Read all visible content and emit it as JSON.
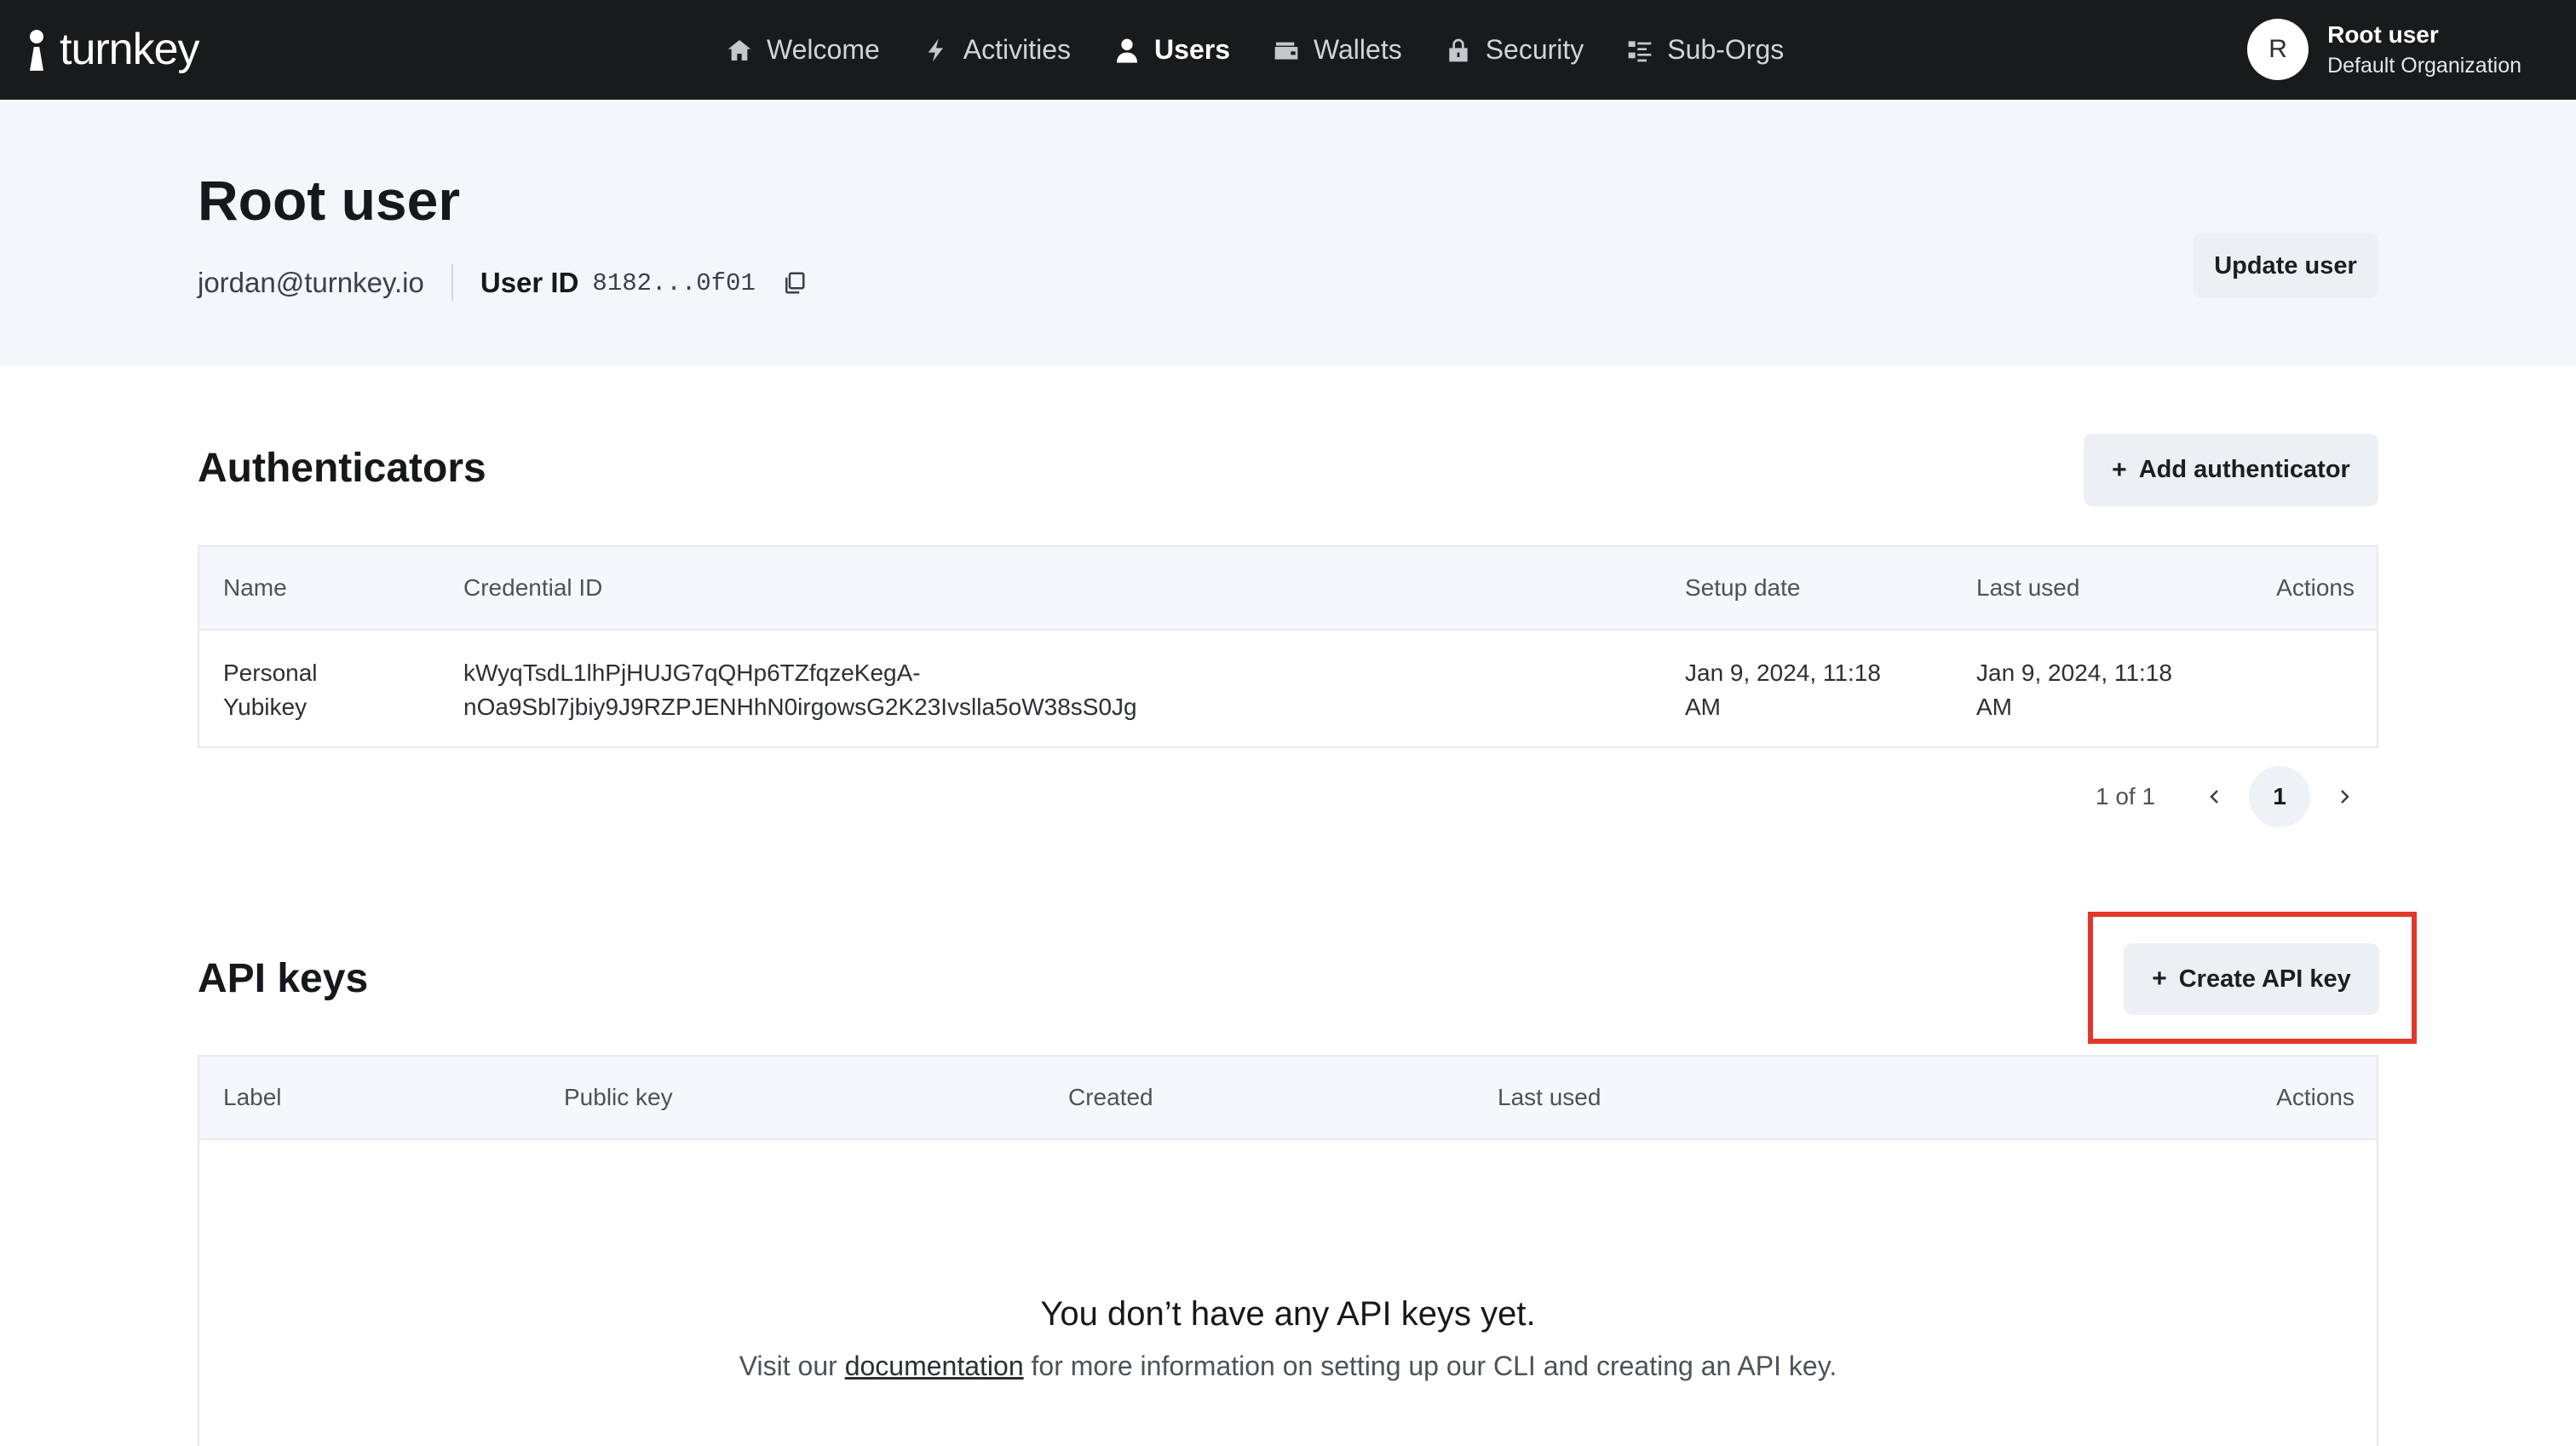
{
  "brand": {
    "name": "turnkey"
  },
  "nav": {
    "items": [
      {
        "label": "Welcome",
        "icon": "home-icon"
      },
      {
        "label": "Activities",
        "icon": "lightning-icon"
      },
      {
        "label": "Users",
        "icon": "user-icon",
        "active": true
      },
      {
        "label": "Wallets",
        "icon": "wallet-icon"
      },
      {
        "label": "Security",
        "icon": "lock-icon"
      },
      {
        "label": "Sub-Orgs",
        "icon": "list-icon"
      }
    ]
  },
  "current_user": {
    "initial": "R",
    "name": "Root user",
    "organization": "Default Organization"
  },
  "profile": {
    "title": "Root user",
    "email": "jordan@turnkey.io",
    "user_id_label": "User ID",
    "user_id_value": "8182...0f01",
    "update_button": "Update user"
  },
  "authenticators": {
    "title": "Authenticators",
    "add_button": "Add authenticator",
    "columns": [
      "Name",
      "Credential ID",
      "Setup date",
      "Last used",
      "Actions"
    ],
    "rows": [
      {
        "name_line1": "Personal",
        "name_line2": "Yubikey",
        "credential_line1": "kWyqTsdL1lhPjHUJG7qQHp6TZfqzeKegA-",
        "credential_line2": "nOa9Sbl7jbiy9J9RZPJENHhN0irgowsG2K23Ivslla5oW38sS0Jg",
        "setup_line1": "Jan 9, 2024, 11:18",
        "setup_line2": "AM",
        "last_used_line1": "Jan 9, 2024, 11:18",
        "last_used_line2": "AM"
      }
    ],
    "pagination": {
      "info": "1 of 1",
      "current_page": "1"
    }
  },
  "api_keys": {
    "title": "API keys",
    "create_button": "Create API key",
    "columns": [
      "Label",
      "Public key",
      "Created",
      "Last used",
      "Actions"
    ],
    "empty_title": "You don’t have any API keys yet.",
    "empty_desc_prefix": "Visit our ",
    "empty_desc_link": "documentation",
    "empty_desc_suffix": " for more information on setting up our CLI and creating an API key."
  },
  "colors": {
    "navbar_bg": "#191a1c",
    "profile_band_bg": "#f3f6fb",
    "button_bg": "#eceff3",
    "highlight": "#e0392a"
  }
}
